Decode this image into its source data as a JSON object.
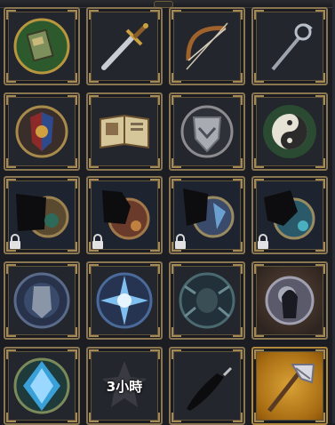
{
  "inventory": {
    "items": [
      {
        "name": "green-book-emblem",
        "state": "available"
      },
      {
        "name": "gold-sword",
        "state": "available"
      },
      {
        "name": "wooden-bow",
        "state": "available"
      },
      {
        "name": "ornate-staff",
        "state": "available"
      },
      {
        "name": "heraldic-crest",
        "state": "available"
      },
      {
        "name": "open-spellbook",
        "state": "available"
      },
      {
        "name": "winged-shield-badge",
        "state": "available"
      },
      {
        "name": "yin-yang-medallion",
        "state": "available"
      },
      {
        "name": "locked-dark-crest",
        "state": "locked"
      },
      {
        "name": "locked-dragon-crest",
        "state": "locked"
      },
      {
        "name": "locked-blue-beast-crest",
        "state": "locked"
      },
      {
        "name": "locked-teal-beast-crest",
        "state": "locked"
      },
      {
        "name": "armored-knight-emblem",
        "state": "available"
      },
      {
        "name": "blue-star-burst-emblem",
        "state": "available"
      },
      {
        "name": "spider-emblem",
        "state": "available"
      },
      {
        "name": "hooded-reaper-orb",
        "state": "available"
      },
      {
        "name": "blue-crystal-emblem",
        "state": "available"
      },
      {
        "name": "cooldown-item",
        "state": "cooldown",
        "timer": "3小時"
      },
      {
        "name": "black-quill",
        "state": "available"
      },
      {
        "name": "silver-axe",
        "state": "selected"
      }
    ]
  },
  "colors": {
    "frame": "#8a7650",
    "background": "#1c1d22",
    "gold_tile": "#d9a236"
  }
}
